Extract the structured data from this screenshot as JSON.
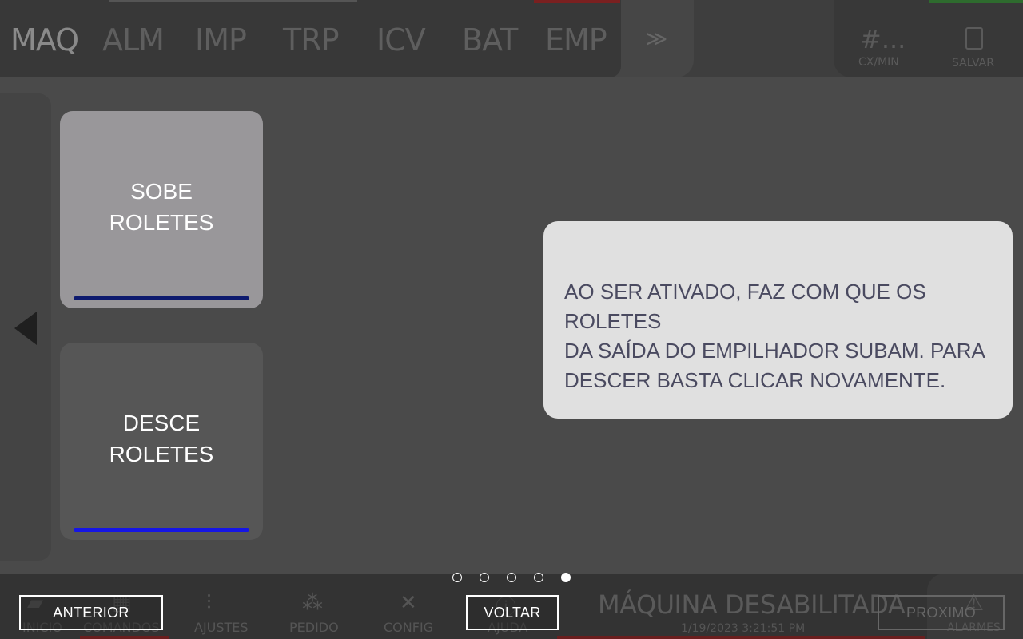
{
  "header": {
    "tabs": [
      {
        "label": "MAQ",
        "active": true
      },
      {
        "label": "ALM"
      },
      {
        "label": "IMP"
      },
      {
        "label": "TRP"
      },
      {
        "label": "ICV"
      },
      {
        "label": "BAT"
      },
      {
        "label": "EMP"
      }
    ],
    "more_label": "≫",
    "rate_value": "#...",
    "rate_label": "CX/MIN",
    "save_label": "SALVAR"
  },
  "commands": {
    "up": {
      "line1": "SOBE",
      "line2": "ROLETES"
    },
    "down": {
      "line1": "DESCE",
      "line2": "ROLETES"
    }
  },
  "info": {
    "text": "AO SER ATIVADO, FAZ COM QUE OS ROLETES\nDA SAÍDA DO EMPILHADOR SUBAM. PARA\nDESCER BASTA CLICAR NOVAMENTE."
  },
  "pagination": {
    "total": 5,
    "current": 5
  },
  "tutorial_buttons": {
    "previous": "ANTERIOR",
    "back": "VOLTAR",
    "next": "PROXIMO"
  },
  "bottom_nav": {
    "items": [
      "INICIO",
      "COMANDOS",
      "AJUSTES",
      "PEDIDO",
      "CONFIG",
      "AJUDA"
    ],
    "status": "MÁQUINA DESABILITADA",
    "timestamp": "1/19/2023 3:21:51 PM",
    "alarm_label": "ALARMES"
  },
  "colors": {
    "highlight_card": "#99979a",
    "highlight_bar": "#0d1a6e",
    "normal_bar": "#1515e6",
    "info_box": "#e0e0e0",
    "info_text": "#4a4a60"
  }
}
